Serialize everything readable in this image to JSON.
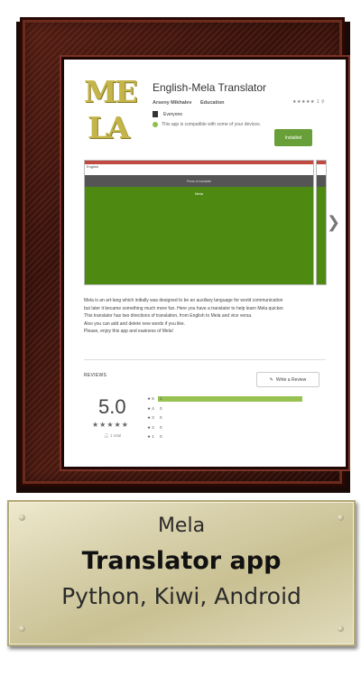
{
  "app": {
    "logo_line1": "ME",
    "logo_line2": "LA",
    "title": "English-Mela Translator",
    "developer": "Arseny Mikhalev",
    "category": "Education",
    "content_rating": "Everyone",
    "compat_text": "This app is compatible with some of your devices.",
    "rating_mini": "★★★★★ 1 ⚲",
    "install_label": "Installed"
  },
  "screenshot": {
    "tab_label": "English",
    "bar_label": "Press to translate",
    "green_label": "Mela",
    "next_icon": "chevron-right-icon"
  },
  "description": {
    "lines": [
      "Mela is an art-lang which initially was designed to be an auxiliary language for world communication",
      "but later it became something much more fun. Here you have a translator to help learn Mela quicker.",
      "This translator has two directions of translation, from English to Mela and vice versa.",
      "Also you can add and delete new words if you like.",
      "Please, enjoy this app and easiness of Mela!"
    ]
  },
  "reviews": {
    "heading": "REVIEWS",
    "write_label": "Write a Review",
    "score": "5.0",
    "stars": "★★★★★",
    "total": "1 total",
    "breakdown": [
      {
        "label": "★ 5",
        "count": "1",
        "fraction": 1.0
      },
      {
        "label": "★ 4",
        "count": "0",
        "fraction": 0
      },
      {
        "label": "★ 3",
        "count": "0",
        "fraction": 0
      },
      {
        "label": "★ 2",
        "count": "0",
        "fraction": 0
      },
      {
        "label": "★ 1",
        "count": "0",
        "fraction": 0
      }
    ]
  },
  "plaque": {
    "line1": "Mela",
    "line2": "Translator app",
    "line3": "Python, Kiwi, Android"
  },
  "colors": {
    "install_green": "#689f38",
    "screenshot_green": "#4e8a12",
    "bar_green": "#97c150",
    "frame_wood": "#3b120b"
  }
}
